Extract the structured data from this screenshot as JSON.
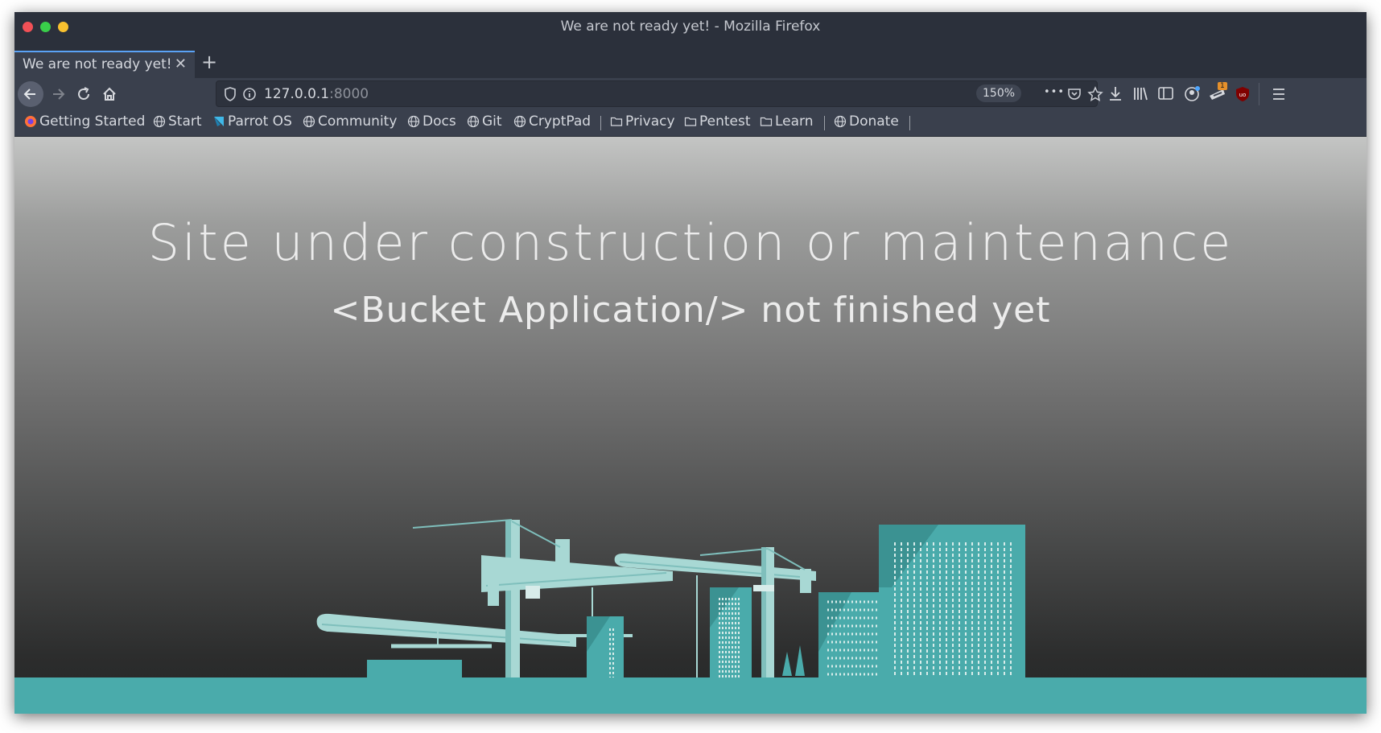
{
  "window": {
    "title": "We are not ready yet! - Mozilla Firefox"
  },
  "tabs": [
    {
      "label": "We are not ready yet!",
      "close_glyph": "✕",
      "active": true
    }
  ],
  "new_tab_glyph": "+",
  "navbar": {
    "url_host": "127.0.0.1",
    "url_port": ":8000",
    "zoom": "150%",
    "more_glyph": "•••"
  },
  "bookmarks": [
    {
      "label": "Getting Started",
      "icon": "firefox-icon"
    },
    {
      "label": "Start",
      "icon": "globe-icon"
    },
    {
      "label": "Parrot OS",
      "icon": "parrot-icon"
    },
    {
      "label": "Community",
      "icon": "globe-icon"
    },
    {
      "label": "Docs",
      "icon": "globe-icon"
    },
    {
      "label": "Git",
      "icon": "globe-icon"
    },
    {
      "label": "CryptPad",
      "icon": "globe-icon"
    },
    {
      "label": "Privacy",
      "icon": "folder-icon"
    },
    {
      "label": "Pentest",
      "icon": "folder-icon"
    },
    {
      "label": "Learn",
      "icon": "folder-icon"
    },
    {
      "label": "Donate",
      "icon": "globe-icon"
    }
  ],
  "page": {
    "headline": "Site under construction or maintenance",
    "subline": "<Bucket Application/> not finished yet"
  },
  "extension_badge": "1",
  "colors": {
    "accent_tab": "#5aa2f5",
    "teal": "#4aabab",
    "crane": "#a8d8d4"
  }
}
